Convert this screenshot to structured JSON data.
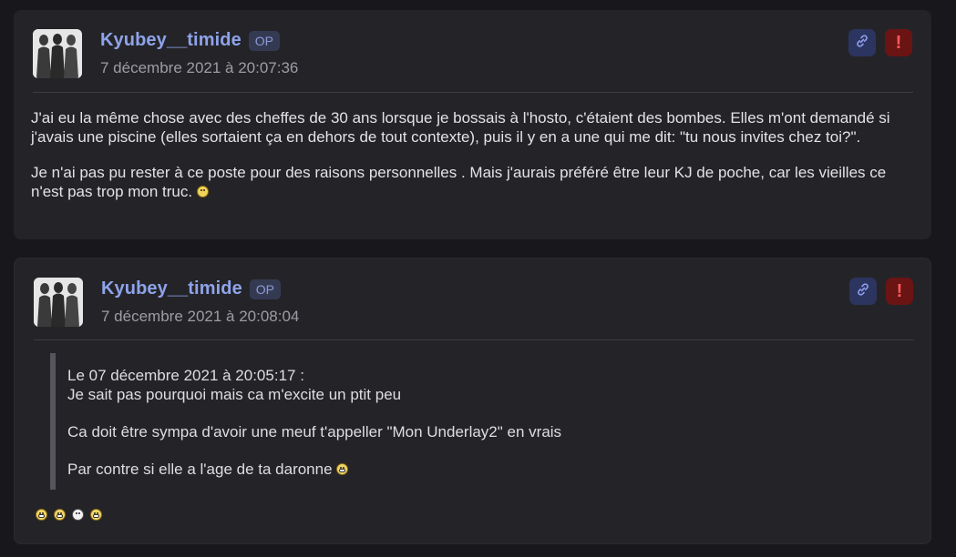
{
  "posts": [
    {
      "author": "Kyubey__timide",
      "badge": "OP",
      "date": "7 décembre 2021 à 20:07:36",
      "paragraphs": [
        "J'ai eu la même chose avec des cheffes de 30 ans lorsque je bossais à l'hosto, c'étaient des bombes. Elles m'ont demandé si j'avais une piscine (elles sortaient ça en dehors de tout contexte), puis il y en a une qui me dit: \"tu nous invites chez toi?\".",
        "Je n'ai pas pu rester à ce poste pour des raisons personnelles . Mais j'aurais préféré être leur KJ de poche, car les vieilles ce n'est pas trop mon truc."
      ]
    },
    {
      "author": "Kyubey__timide",
      "badge": "OP",
      "date": "7 décembre 2021 à 20:08:04",
      "quote": {
        "header": "Le 07 décembre 2021 à 20:05:17 :",
        "lines": [
          "Je sait pas pourquoi mais ca m'excite un ptit peu",
          "Ca doit être sympa d'avoir une meuf t'appeller \"Mon Underlay2\" en vrais",
          "Par contre si elle a l'age de ta daronne"
        ]
      }
    }
  ],
  "icons": {
    "link": "link-icon",
    "report": "exclamation-icon",
    "report_glyph": "!",
    "smiley": "smiley-icon"
  },
  "colors": {
    "background": "#18181c",
    "card": "#242428",
    "author": "#8fa3ea",
    "report": "#6a1414",
    "link_button": "#2c3560"
  }
}
